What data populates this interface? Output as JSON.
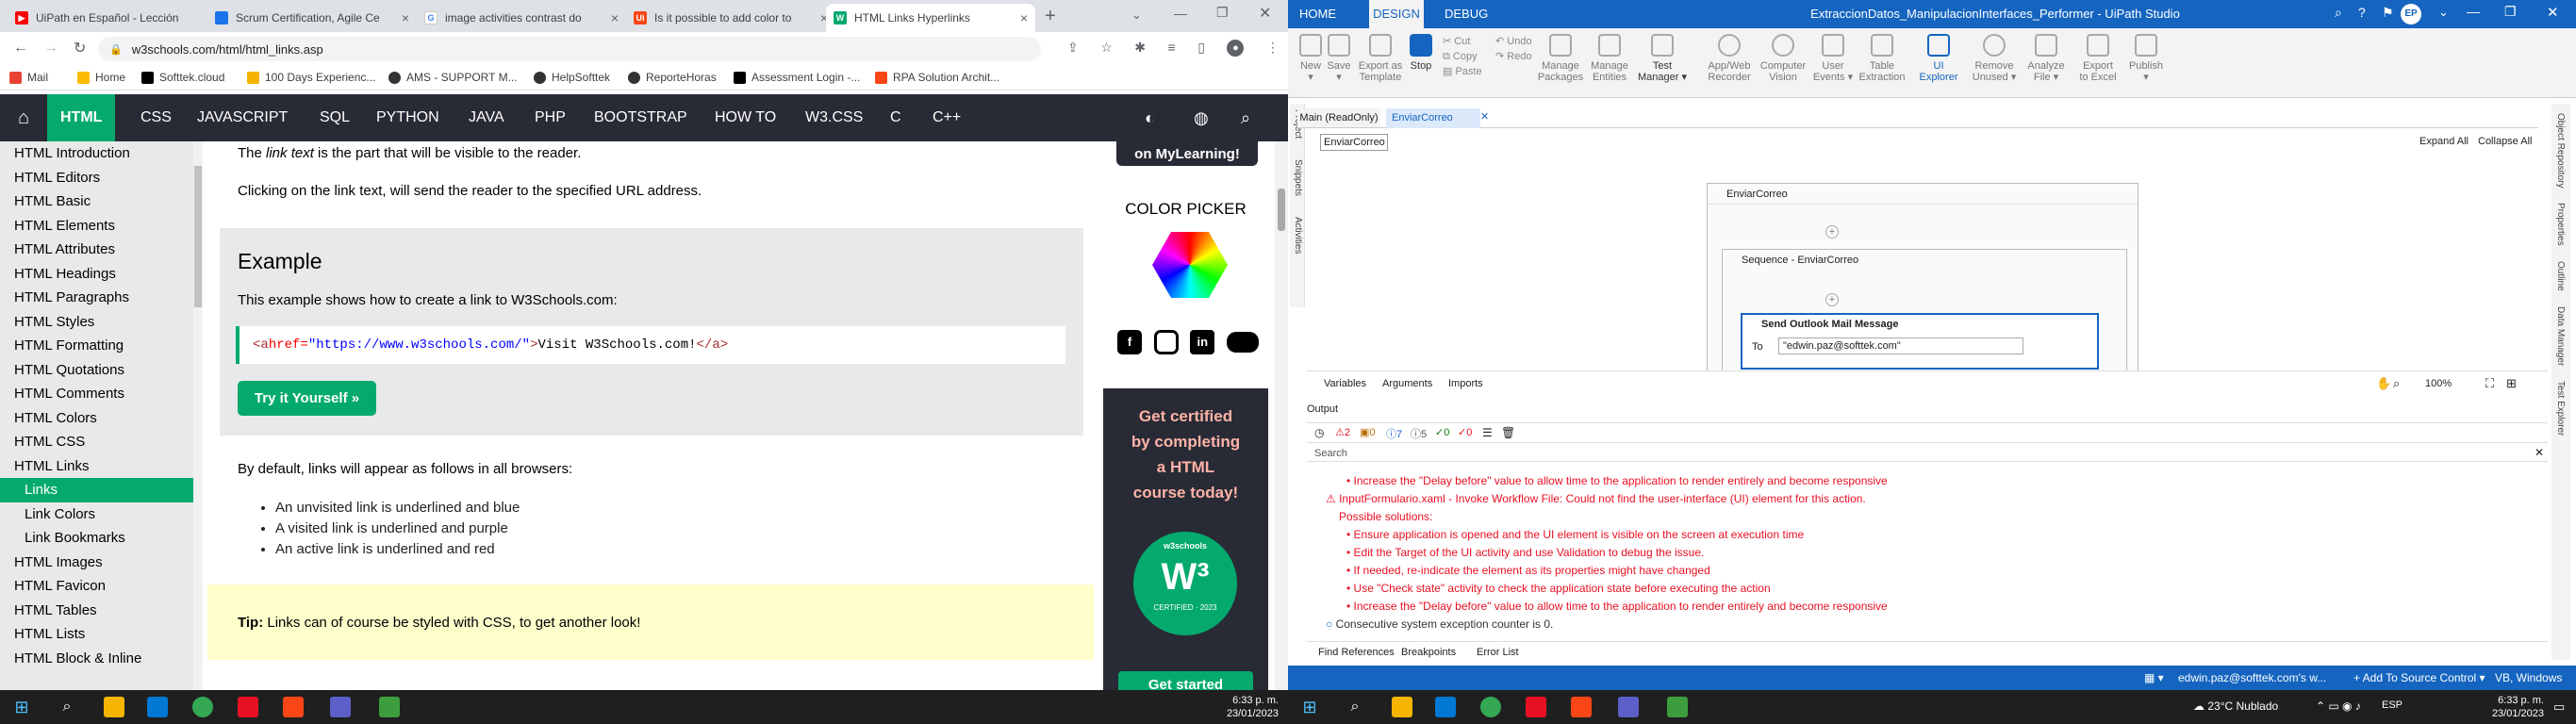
{
  "browser": {
    "tabs": [
      {
        "title": "UiPath en Español - Lección",
        "color": "#ff0000"
      },
      {
        "title": "Scrum Certification, Agile Ce",
        "color": "#1a73e8"
      },
      {
        "title": "image activities contrast do",
        "color": "#4285f4"
      },
      {
        "title": "Is it possible to add color to",
        "color": "#fa4616"
      },
      {
        "title": "HTML Links Hyperlinks",
        "color": "#04aa6d"
      }
    ],
    "new_tab": "+",
    "url": "w3schools.com/html/html_links.asp",
    "bookmarks": [
      "Mail",
      "Home",
      "Softtek.cloud",
      "100 Days Experienc...",
      "AMS - SUPPORT M...",
      "HelpSofttek",
      "ReporteHoras",
      "Assessment Login -...",
      "RPA Solution Archit..."
    ]
  },
  "w3": {
    "nav": [
      "HTML",
      "CSS",
      "JAVASCRIPT",
      "SQL",
      "PYTHON",
      "JAVA",
      "PHP",
      "BOOTSTRAP",
      "HOW TO",
      "W3.CSS",
      "C",
      "C++"
    ],
    "side": [
      "HTML Introduction",
      "HTML Editors",
      "HTML Basic",
      "HTML Elements",
      "HTML Attributes",
      "HTML Headings",
      "HTML Paragraphs",
      "HTML Styles",
      "HTML Formatting",
      "HTML Quotations",
      "HTML Comments",
      "HTML Colors",
      "HTML CSS",
      "HTML Links",
      "Links",
      "Link Colors",
      "Link Bookmarks",
      "HTML Images",
      "HTML Favicon",
      "HTML Tables",
      "HTML Lists",
      "HTML Block & Inline"
    ],
    "p1_pre": "The ",
    "p1_em": "link text",
    "p1_post": " is the part that will be visible to the reader.",
    "p2": "Clicking on the link text, will send the reader to the specified URL address.",
    "example_title": "Example",
    "example_desc": "This example shows how to create a link to W3Schools.com:",
    "code_tag_open": "<a ",
    "code_attr": "href=",
    "code_val": "\"https://www.w3schools.com/\"",
    "code_close": ">",
    "code_text": "Visit W3Schools.com!",
    "code_end": "</a>",
    "try_button": "Try it Yourself »",
    "default_text": "By default, links will appear as follows in all browsers:",
    "bullets": [
      "An unvisited link is underlined and blue",
      "A visited link is underlined and purple",
      "An active link is underlined and red"
    ],
    "tip_label": "Tip:",
    "tip_text": " Links can of course be styled with CSS, to get another look!",
    "mylearning": "on MyLearning!",
    "color_picker": "COLOR PICKER",
    "promo_lines": [
      "Get certified",
      "by completing",
      "a HTML",
      "course today!"
    ],
    "badge": "w3schools",
    "badge_bottom": "CERTIFIED · 2023",
    "get_started": "Get started"
  },
  "uipath": {
    "ribbon_tabs": [
      "HOME",
      "DESIGN",
      "DEBUG"
    ],
    "window_title": "ExtraccionDatos_ManipulacionInterfaces_Performer - UiPath Studio",
    "user_initials": "EP",
    "ribbon": [
      {
        "label": "New",
        "sub": "▾"
      },
      {
        "label": "Save",
        "sub": "▾"
      },
      {
        "label": "Export as",
        "sub": "Template"
      },
      {
        "label": "Stop",
        "sub": ""
      },
      {
        "label": "Manage",
        "sub": "Packages"
      },
      {
        "label": "Manage",
        "sub": "Entities"
      },
      {
        "label": "Test",
        "sub": "Manager ▾"
      },
      {
        "label": "App/Web",
        "sub": "Recorder"
      },
      {
        "label": "Computer",
        "sub": "Vision"
      },
      {
        "label": "User",
        "sub": "Events ▾"
      },
      {
        "label": "Table",
        "sub": "Extraction"
      },
      {
        "label": "UI",
        "sub": "Explorer"
      },
      {
        "label": "Remove",
        "sub": "Unused ▾"
      },
      {
        "label": "Analyze",
        "sub": "File ▾"
      },
      {
        "label": "Export",
        "sub": "to Excel"
      },
      {
        "label": "Publish",
        "sub": "▾"
      }
    ],
    "clipboard": [
      "Cut",
      "Copy",
      "Paste"
    ],
    "undo": [
      "Undo",
      "Redo"
    ],
    "doc_tabs": [
      "Main (ReadOnly)",
      "EnviarCorreo (ReadOnly)"
    ],
    "breadcrumb": "EnviarCorreo",
    "expand_all": "Expand All",
    "collapse_all": "Collapse All",
    "activity_outer": "EnviarCorreo",
    "activity_seq": "Sequence - EnviarCorreo",
    "activity_mail": "Send Outlook Mail Message",
    "to_label": "To",
    "to_value": "\"edwin.paz@softtek.com\"",
    "bottom_tabs": [
      "Variables",
      "Arguments",
      "Imports"
    ],
    "zoom": "100%",
    "output_title": "Output",
    "counters": [
      "2",
      "0",
      "7",
      "5",
      "0",
      "0"
    ],
    "search": "Search",
    "log_lines": [
      "• Increase the \"Delay before\" value to allow time to the application to render entirely and become responsive",
      "⚠ InputFormulario.xaml - Invoke Workflow File: Could not find the user-interface (UI) element for this action.",
      "Possible solutions:",
      "• Ensure application is opened and the UI element is visible on the screen at execution time",
      "• Edit the Target of the UI activity and use Validation to debug the issue.",
      "• If needed, re-indicate the element as its properties might have changed",
      "• Use \"Check state\" activity to check the application state before executing the action",
      "• Increase the \"Delay before\" value to allow time to the application to render entirely and become responsive"
    ],
    "info_line": "Consecutive system exception counter is 0.",
    "panel_tabs": [
      "Find References",
      "Breakpoints",
      "Error List"
    ],
    "side_left": [
      "Project",
      "Snippets",
      "Activities"
    ],
    "side_right": [
      "Object Repository",
      "Properties",
      "Outline",
      "Data Manager",
      "Test Explorer"
    ],
    "status_user": "edwin.paz@softtek.com's w...",
    "status_source": "+ Add To Source Control ▾",
    "status_version": "VB, Windows"
  },
  "taskbar": {
    "time": "6:33 p. m.",
    "date": "23/01/2023",
    "weather": "23°C  Nublado",
    "lang": "ESP"
  }
}
